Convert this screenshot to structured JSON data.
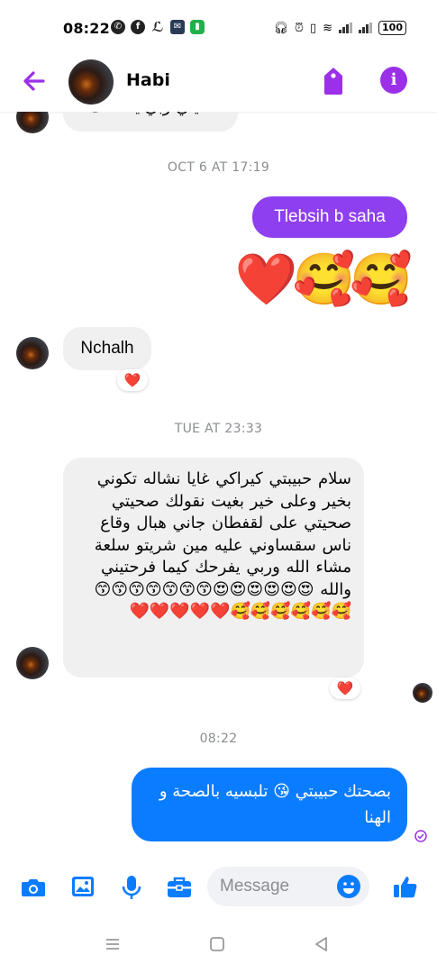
{
  "status_bar": {
    "time": "08:22",
    "left_icons": [
      "whatsapp-icon",
      "facebook-icon",
      "app-icon",
      "email-icon",
      "battery-app-icon"
    ],
    "right_icons": [
      "headphones-icon",
      "alarm-icon",
      "vibrate-icon",
      "wifi-icon",
      "signal-icon",
      "signal-icon"
    ],
    "battery": "100"
  },
  "header": {
    "contact_name": "Habi",
    "accent_color": "#9b30e8"
  },
  "messages": {
    "partial_top_text": "صحيتي ربي يحفظك",
    "timestamp_1": "OCT 6 AT 17:19",
    "out_1": "Tlebsih b saha",
    "out_emojis": "❤️🥰🥰",
    "in_1": "Nchalh",
    "in_1_reaction": "❤️",
    "timestamp_2": "TUE AT 23:33",
    "in_2_text": "سلام حبيبتي كيراكي غايا نشاله تكوني بخير وعلى خير بغيت نقولك صحيتي صحيتي على لقفطان جاني هبال وقاع ناس سقساوني عليه مين شريتو سلعة مشاء الله وربي يفرحك كيما فرحتيني والله 😍😍😍😍😍😍😙😙😙😙😙😙😙🥰🥰🥰🥰🥰🥰❤️❤️❤️❤️❤️",
    "in_2_reaction": "❤️",
    "timestamp_3": "08:22",
    "out_2": "بصحتك حبيبتي 😘 تلبسيه بالصحة و الهنا",
    "bubble_color": "#0a7cff",
    "seen_color": "#9b30e8"
  },
  "composer": {
    "placeholder": "Message",
    "icons": [
      "camera-icon",
      "gallery-icon",
      "microphone-icon",
      "briefcase-icon",
      "emoji-icon",
      "thumbs-up-icon"
    ]
  },
  "nav": {
    "icons": [
      "menu-icon",
      "home-icon",
      "back-triangle-icon"
    ]
  }
}
